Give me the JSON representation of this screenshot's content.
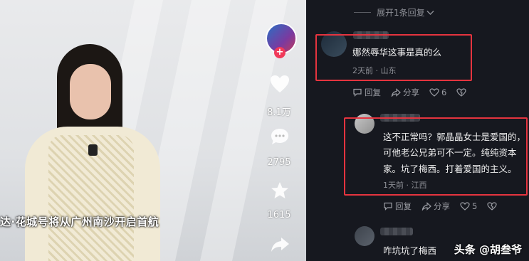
{
  "video": {
    "subtitle": "达·花城号将从广州南沙开启首航",
    "likes": "8.1万",
    "comments_count": "2795",
    "favorites": "1615",
    "plus_icon": "plus-icon"
  },
  "comments": {
    "expand_label": "展开1条回复",
    "items": [
      {
        "text": "娜然辱华这事是真的么",
        "meta": "2天前 · 山东",
        "reply": "回复",
        "share": "分享",
        "likes": "6"
      },
      {
        "text_lines": [
          "这不正常吗？郭晶晶女士是爱国的，",
          "可他老公兄弟可不一定。纯纯资本",
          "家。坑了梅西。打着爱国的主义。"
        ],
        "meta": "1天前 · 江西",
        "reply": "回复",
        "share": "分享",
        "likes": "5"
      },
      {
        "text": "咋坑坑了梅西"
      }
    ]
  },
  "watermark": "头条 @胡叁爷",
  "colors": {
    "highlight": "#e5343f",
    "panel_bg": "#16181f",
    "accent": "#f03a5a"
  }
}
